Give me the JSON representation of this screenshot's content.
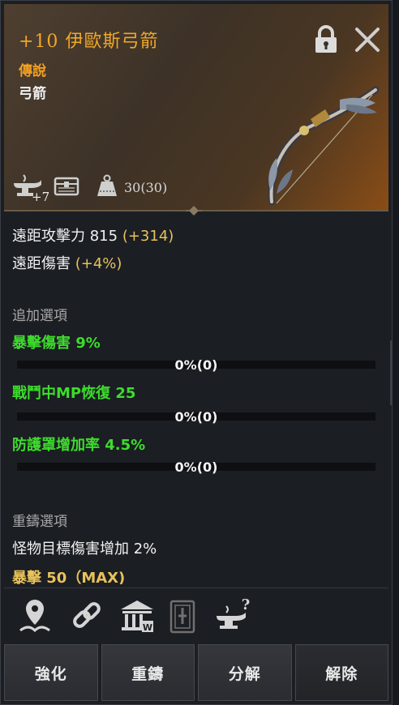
{
  "item": {
    "enhance": "+10",
    "name": "伊歐斯弓箭",
    "grade": "傳說",
    "type": "弓箭",
    "enchant_badge": "+7",
    "weight": "30(30)"
  },
  "stats": {
    "ranged_attack_label": "遠距攻擊力 815",
    "ranged_attack_bonus": "(+314)",
    "ranged_damage_label": "遠距傷害",
    "ranged_damage_bonus": "(+4%)"
  },
  "additional": {
    "header": "追加選項",
    "options": [
      {
        "label": "暴擊傷害 9%",
        "progress_text": "0%(0)",
        "progress": 0
      },
      {
        "label": "戰鬥中MP恢復 25",
        "progress_text": "0%(0)",
        "progress": 0
      },
      {
        "label": "防護罩增加率 4.5%",
        "progress_text": "0%(0)",
        "progress": 0
      }
    ]
  },
  "reforge": {
    "header": "重鑄選項",
    "line1": "怪物目標傷害增加 2%",
    "line2": "暴擊 50（MAX)"
  },
  "buttons": {
    "enhance": "強化",
    "reforge": "重鑄",
    "decompose": "分解",
    "release": "解除"
  },
  "icons": [
    "lock-icon",
    "close-icon",
    "anvil-icon",
    "chest-icon",
    "weight-icon",
    "location-pin-icon",
    "link-icon",
    "warehouse-icon",
    "card-icon",
    "anvil-help-icon"
  ],
  "colors": {
    "grade": "#f0a024",
    "option_green": "#3ddc2c",
    "bonus_yellow": "#e8c25a"
  }
}
